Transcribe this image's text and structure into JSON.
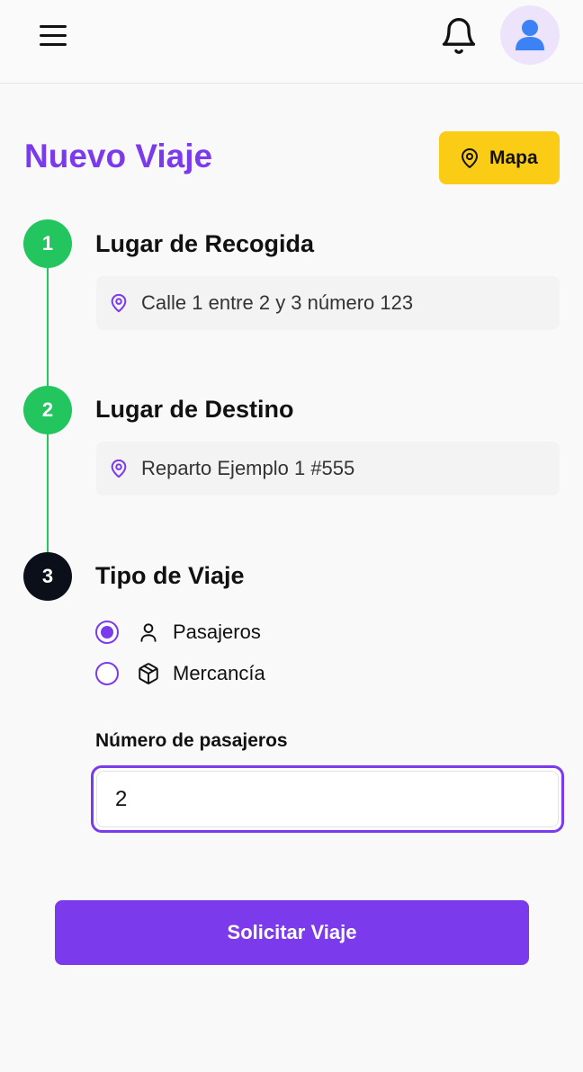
{
  "header": {
    "menu_icon": "hamburger-menu-icon",
    "notification_icon": "bell-icon",
    "avatar_icon": "user-avatar-icon"
  },
  "page": {
    "title": "Nuevo Viaje",
    "map_button_label": "Mapa",
    "map_button_icon": "map-pin-icon"
  },
  "steps": [
    {
      "number": "1",
      "title": "Lugar de Recogida",
      "value": "Calle 1 entre 2 y 3 número 123",
      "status": "completed"
    },
    {
      "number": "2",
      "title": "Lugar de Destino",
      "value": "Reparto Ejemplo 1 #555",
      "status": "completed"
    },
    {
      "number": "3",
      "title": "Tipo de Viaje",
      "status": "active"
    }
  ],
  "trip_type": {
    "options": [
      {
        "label": "Pasajeros",
        "icon": "person-icon",
        "selected": true
      },
      {
        "label": "Mercancía",
        "icon": "package-icon",
        "selected": false
      }
    ]
  },
  "passengers": {
    "label": "Número de pasajeros",
    "value": "2"
  },
  "submit_label": "Solicitar Viaje",
  "colors": {
    "primary": "#7c3aed",
    "accent": "#facc15",
    "success": "#22c55e",
    "active_step": "#0b0f19"
  }
}
